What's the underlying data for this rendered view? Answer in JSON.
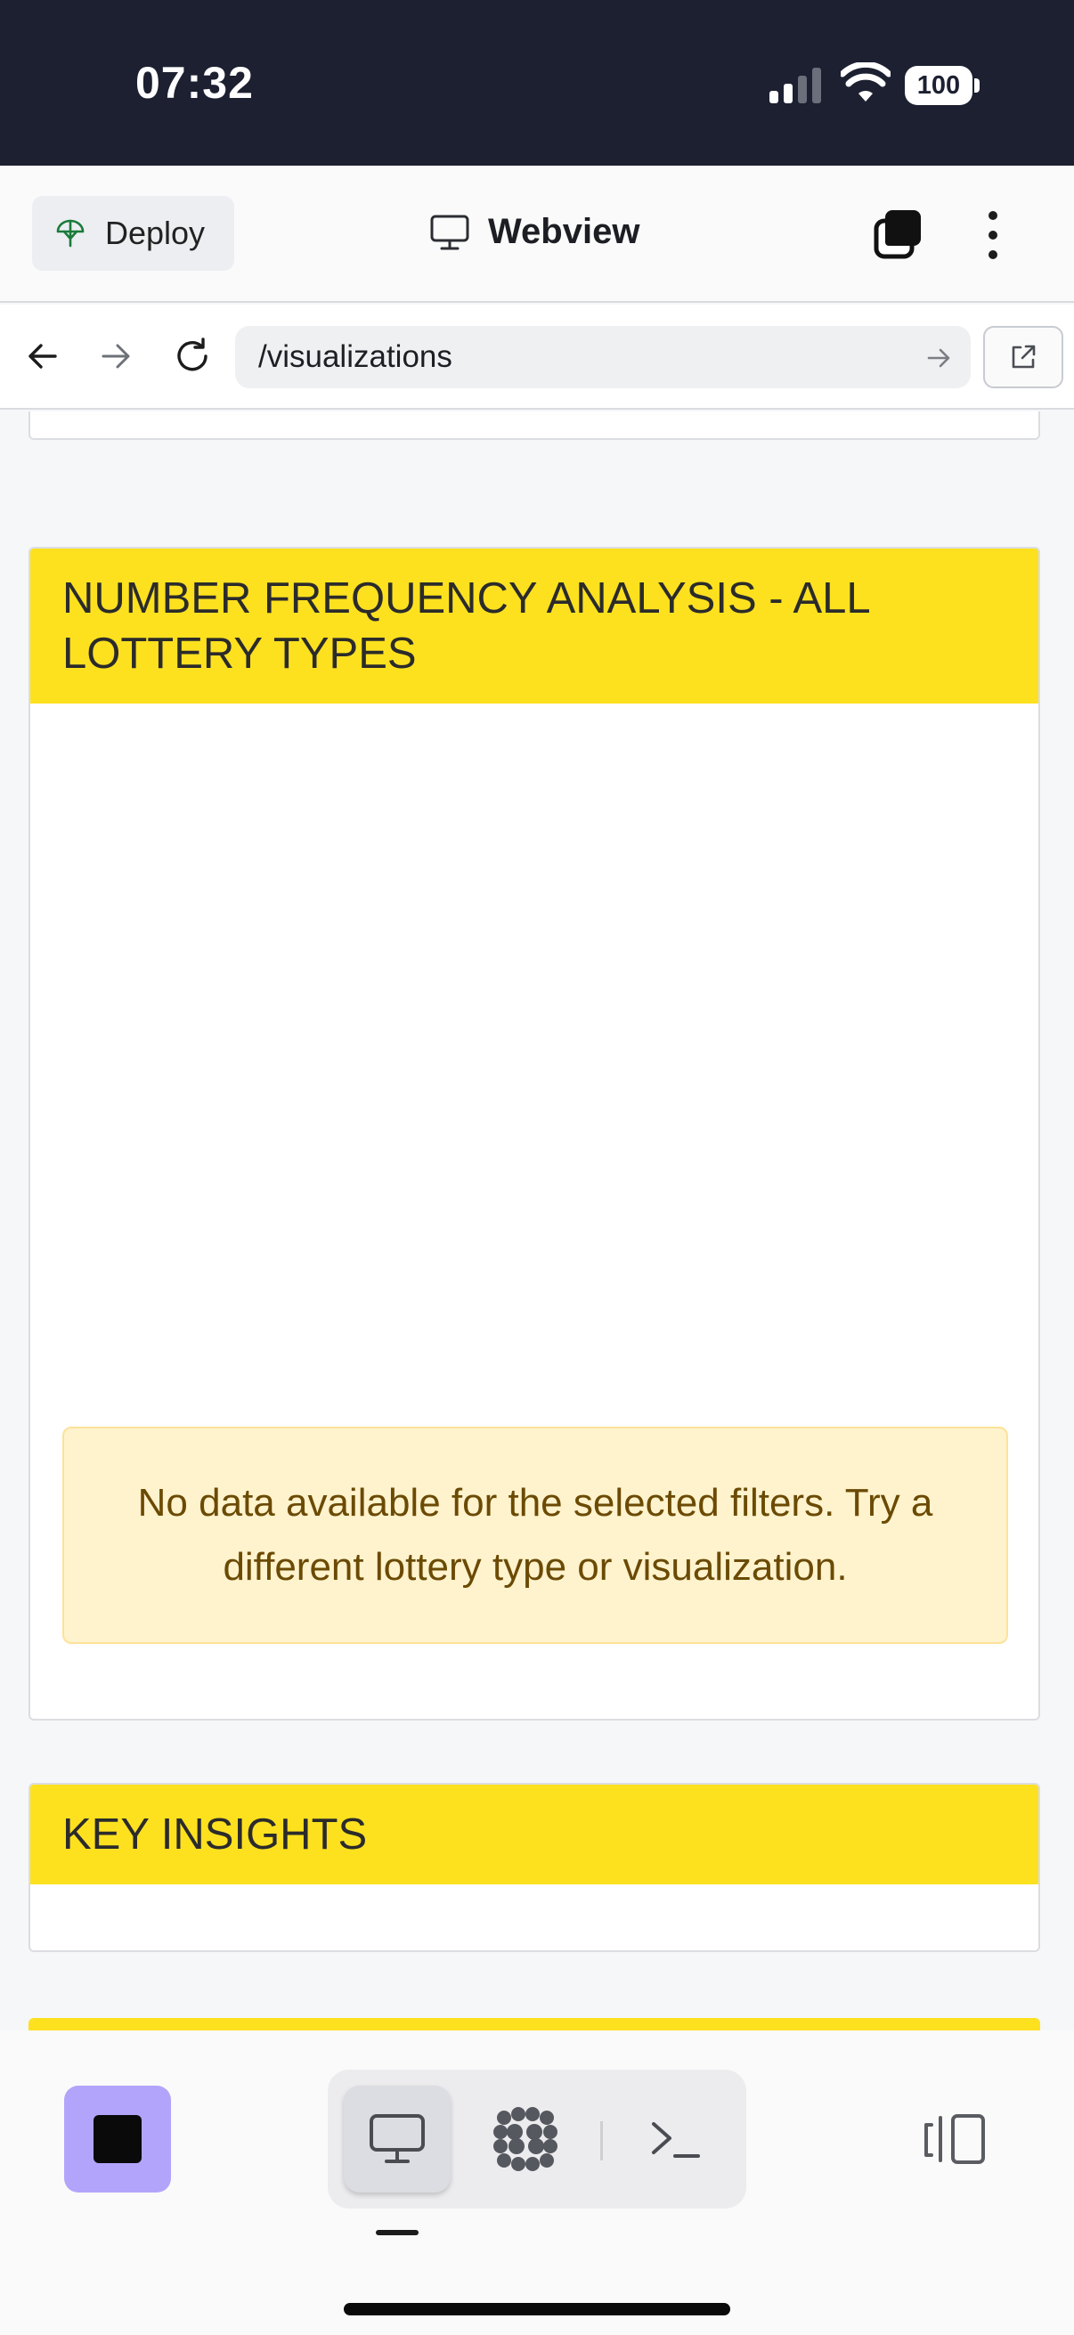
{
  "status_bar": {
    "time": "07:32",
    "battery": "100"
  },
  "toolbar": {
    "deploy_label": "Deploy",
    "title": "Webview"
  },
  "url_bar": {
    "url": "/visualizations"
  },
  "cards": {
    "frequency": {
      "title": "NUMBER FREQUENCY ANALYSIS - ALL LOTTERY TYPES",
      "alert": "No data available for the selected filters. Try a different lottery type or visualization."
    },
    "insights": {
      "title": "KEY INSIGHTS"
    }
  },
  "colors": {
    "status_bg": "#1c2031",
    "card_header": "#fde11f",
    "alert_bg": "#fff3cd",
    "alert_text": "#6b4a04",
    "stop_button": "#b3a4fb"
  },
  "icons": {
    "deploy": "umbrella-icon",
    "title": "monitor-icon",
    "tabs": "tabs-icon",
    "more": "more-vertical-icon",
    "back": "arrow-left-icon",
    "forward": "arrow-right-icon",
    "reload": "reload-icon",
    "go": "arrow-right-icon",
    "open": "external-link-icon",
    "stop": "stop-icon",
    "desktop": "monitor-icon",
    "agent": "grid-dots-icon",
    "console": "terminal-icon",
    "layout": "split-panel-icon"
  }
}
